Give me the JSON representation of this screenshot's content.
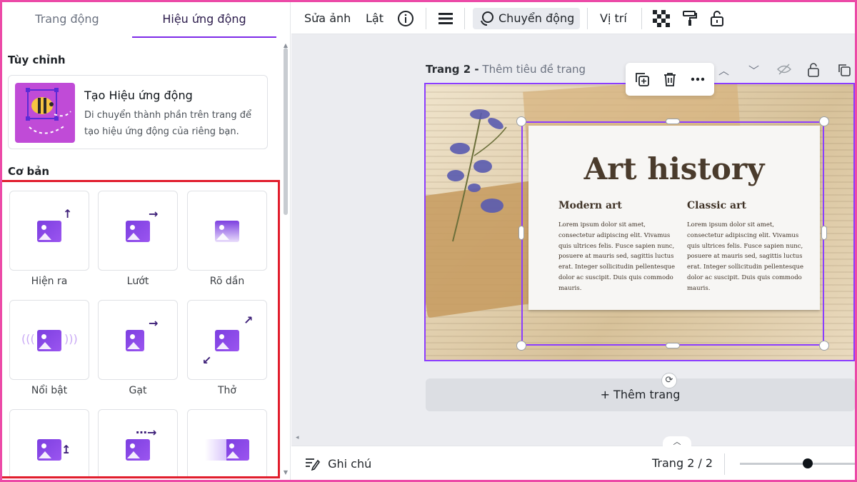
{
  "left_panel": {
    "tabs": [
      "Trang động",
      "Hiệu ứng động"
    ],
    "custom_section": "Tùy chỉnh",
    "create_card": {
      "title": "Tạo Hiệu ứng động",
      "description": "Di chuyển thành phần trên trang để tạo hiệu ứng động của riêng bạn."
    },
    "basic_section": "Cơ bản",
    "animations": [
      "Hiện ra",
      "Lướt",
      "Rõ dần",
      "Nổi bật",
      "Gạt",
      "Thở",
      "",
      "",
      ""
    ]
  },
  "toolbar": {
    "edit_photo": "Sửa ảnh",
    "flip": "Lật",
    "motion": "Chuyển động",
    "position": "Vị trí"
  },
  "canvas": {
    "page_label": "Trang 2 -",
    "page_title_placeholder": "Thêm tiêu đề trang",
    "add_page": "+ Thêm trang",
    "design": {
      "title": "Art history",
      "col1_heading": "Modern art",
      "col2_heading": "Classic art",
      "body": "Lorem ipsum dolor sit amet, consectetur adipiscing elit. Vivamus quis ultrices felis. Fusce sapien nunc, posuere at mauris sed, sagittis luctus erat. Integer sollicitudin pellentesque dolor ac suscipit. Duis quis commodo mauris."
    }
  },
  "bottom_bar": {
    "notes": "Ghi chú",
    "pager": "Trang 2 / 2",
    "zoom_level_fraction": 0.55
  },
  "colors": {
    "accent": "#8b3dff",
    "highlight_frame": "#ec4aa7",
    "highlight_box": "#e11d2c"
  }
}
